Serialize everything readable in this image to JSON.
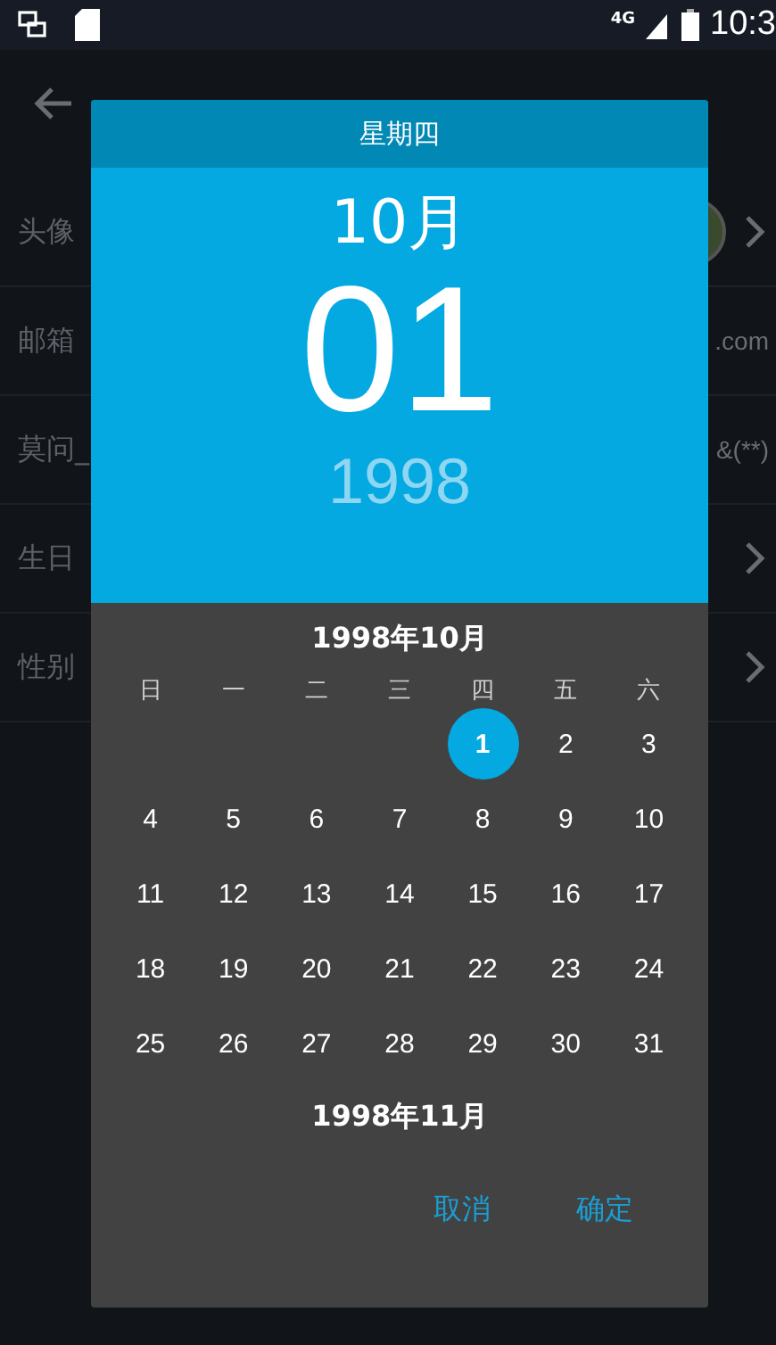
{
  "status_bar": {
    "network": "4G",
    "time": "10:3"
  },
  "profile_rows": [
    {
      "label": "头像",
      "kind": "avatar",
      "chevron": true
    },
    {
      "label": "邮箱",
      "kind": "text",
      "value": ".com",
      "chevron": false
    },
    {
      "label": "莫问_",
      "kind": "text",
      "value": "&(**)",
      "chevron": false
    },
    {
      "label": "生日",
      "kind": "text",
      "chevron": true
    },
    {
      "label": "性别",
      "kind": "text",
      "chevron": true
    }
  ],
  "dialog": {
    "weekday_header": "星期四",
    "month": "10月",
    "day": "01",
    "year": "1998",
    "calendar": {
      "month_title": "1998年10月",
      "weekdays": [
        "日",
        "一",
        "二",
        "三",
        "四",
        "五",
        "六"
      ],
      "weeks": [
        [
          {
            "label": "1",
            "selected": true
          },
          {
            "label": "2",
            "selected": false
          },
          {
            "label": "3",
            "selected": false
          }
        ],
        [
          {
            "label": "4",
            "selected": false
          },
          {
            "label": "5",
            "selected": false
          },
          {
            "label": "6",
            "selected": false
          },
          {
            "label": "7",
            "selected": false
          },
          {
            "label": "8",
            "selected": false
          },
          {
            "label": "9",
            "selected": false
          },
          {
            "label": "10",
            "selected": false
          }
        ],
        [
          {
            "label": "11",
            "selected": false
          },
          {
            "label": "12",
            "selected": false
          },
          {
            "label": "13",
            "selected": false
          },
          {
            "label": "14",
            "selected": false
          },
          {
            "label": "15",
            "selected": false
          },
          {
            "label": "16",
            "selected": false
          },
          {
            "label": "17",
            "selected": false
          }
        ],
        [
          {
            "label": "18",
            "selected": false
          },
          {
            "label": "19",
            "selected": false
          },
          {
            "label": "20",
            "selected": false
          },
          {
            "label": "21",
            "selected": false
          },
          {
            "label": "22",
            "selected": false
          },
          {
            "label": "23",
            "selected": false
          },
          {
            "label": "24",
            "selected": false
          }
        ],
        [
          {
            "label": "25",
            "selected": false
          },
          {
            "label": "26",
            "selected": false
          },
          {
            "label": "27",
            "selected": false
          },
          {
            "label": "28",
            "selected": false
          },
          {
            "label": "29",
            "selected": false
          },
          {
            "label": "30",
            "selected": false
          },
          {
            "label": "31",
            "selected": false
          }
        ]
      ],
      "next_month_title": "1998年11月"
    },
    "buttons": [
      "取消",
      "确定"
    ]
  }
}
